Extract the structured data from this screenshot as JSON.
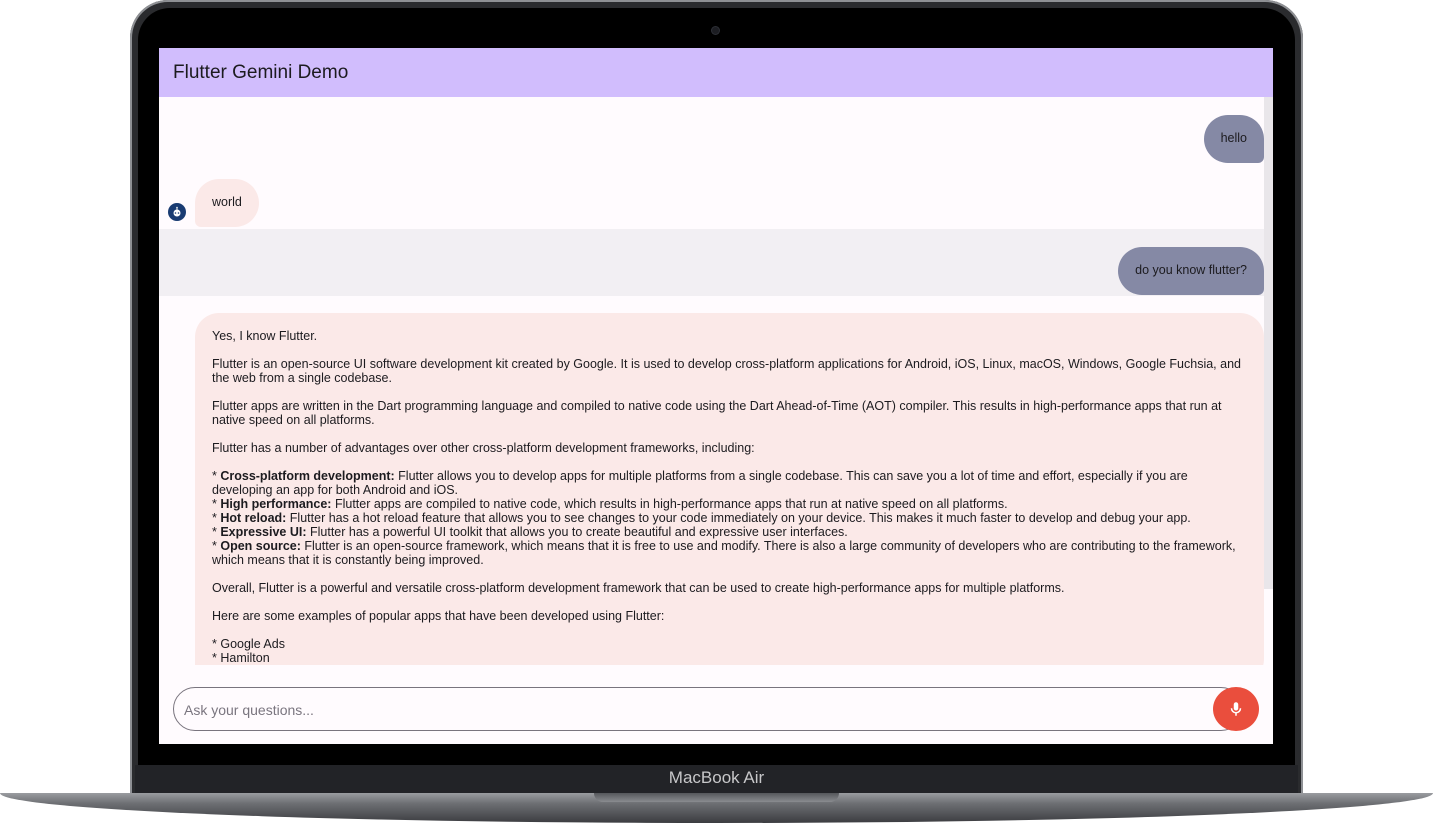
{
  "device": {
    "label": "MacBook Air"
  },
  "app": {
    "title": "Flutter Gemini Demo"
  },
  "messages": [
    {
      "role": "user",
      "text": "hello"
    },
    {
      "role": "bot",
      "text": "world"
    },
    {
      "role": "user",
      "text": "do you know flutter?"
    },
    {
      "role": "bot",
      "intro": "Yes, I know Flutter.",
      "p1": "Flutter is an open-source UI software development kit created by Google. It is used to develop cross-platform applications for Android, iOS, Linux, macOS, Windows, Google Fuchsia, and the web from a single codebase.",
      "p2": "Flutter apps are written in the Dart programming language and compiled to native code using the Dart Ahead-of-Time (AOT) compiler. This results in high-performance apps that run at native speed on all platforms.",
      "p3": "Flutter has a number of advantages over other cross-platform development frameworks, including:",
      "bullets": [
        {
          "b": "Cross-platform development:",
          "t": " Flutter allows you to develop apps for multiple platforms from a single codebase. This can save you a lot of time and effort, especially if you are developing an app for both Android and iOS."
        },
        {
          "b": "High performance:",
          "t": " Flutter apps are compiled to native code, which results in high-performance apps that run at native speed on all platforms."
        },
        {
          "b": "Hot reload:",
          "t": " Flutter has a hot reload feature that allows you to see changes to your code immediately on your device. This makes it much faster to develop and debug your app."
        },
        {
          "b": "Expressive UI:",
          "t": " Flutter has a powerful UI toolkit that allows you to create beautiful and expressive user interfaces."
        },
        {
          "b": "Open source:",
          "t": " Flutter is an open-source framework, which means that it is free to use and modify. There is also a large community of developers who are contributing to the framework, which means that it is constantly being improved."
        }
      ],
      "p4": "Overall, Flutter is a powerful and versatile cross-platform development framework that can be used to create high-performance apps for multiple platforms.",
      "p5": "Here are some examples of popular apps that have been developed using Flutter:",
      "apps": [
        "Google Ads",
        "Hamilton"
      ]
    }
  ],
  "input": {
    "placeholder": "Ask your questions..."
  },
  "icons": {
    "avatar": "robot-icon",
    "mic": "mic-icon"
  },
  "colors": {
    "appbar": "#d1bdfd",
    "user_bubble": "#8589a5",
    "bot_bubble": "#fbe9e8",
    "mic_button": "#ea4e3d"
  }
}
